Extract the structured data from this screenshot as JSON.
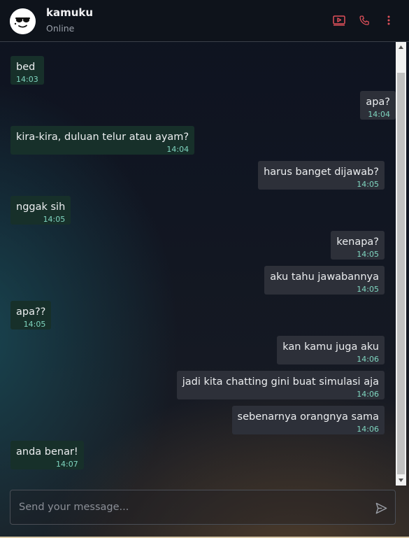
{
  "header": {
    "name": "kamuku",
    "status": "Online"
  },
  "colors": {
    "accent": "#e0505a",
    "incoming_bubble": "#17302a",
    "outgoing_bubble": "#2d3039",
    "timestamp": "#7fd6c0"
  },
  "messages": [
    {
      "dir": "in",
      "text": "bed",
      "time": "14:03"
    },
    {
      "dir": "out",
      "text": "apa?",
      "time": "14:04"
    },
    {
      "dir": "in",
      "text": "kira-kira, duluan telur atau ayam?",
      "time": "14:04"
    },
    {
      "dir": "out",
      "text": "harus banget dijawab?",
      "time": "14:05"
    },
    {
      "dir": "in",
      "text": "nggak sih",
      "time": "14:05"
    },
    {
      "dir": "out",
      "text": "kenapa?",
      "time": "14:05"
    },
    {
      "dir": "out",
      "text": "aku tahu jawabannya",
      "time": "14:05"
    },
    {
      "dir": "in",
      "text": "apa??",
      "time": "14:05"
    },
    {
      "dir": "out",
      "text": "kan kamu juga aku",
      "time": "14:06"
    },
    {
      "dir": "out",
      "text": "jadi kita chatting gini buat simulasi aja",
      "time": "14:06"
    },
    {
      "dir": "out",
      "text": "sebenarnya orangnya sama",
      "time": "14:06"
    },
    {
      "dir": "in",
      "text": "anda benar!",
      "time": "14:07"
    }
  ],
  "composer": {
    "placeholder": "Send your message..."
  }
}
